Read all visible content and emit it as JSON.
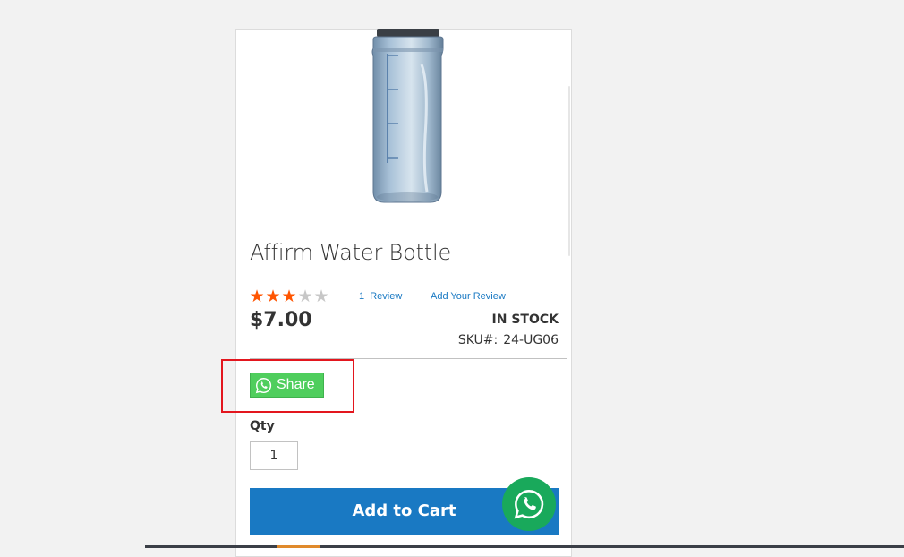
{
  "product": {
    "name": "Affirm Water Bottle",
    "rating": 3,
    "rating_max": 5,
    "review_link": "1  Review",
    "add_review_link": "Add Your Review",
    "price": "$7.00",
    "stock_status": "IN STOCK",
    "sku_label": "SKU#:",
    "sku_value": "24-UG06"
  },
  "share": {
    "label": "Share",
    "icon": "whatsapp-icon",
    "brand_color": "#4fce5d"
  },
  "qty": {
    "label": "Qty",
    "value": "1"
  },
  "cart": {
    "button_label": "Add to Cart",
    "accent_color": "#1979c3"
  },
  "floating_chat": {
    "icon": "whatsapp-icon",
    "color": "#19a95b"
  },
  "colors": {
    "star_on": "#ff5501",
    "star_off": "#c7c7c7",
    "highlight_border": "#e3161e"
  }
}
